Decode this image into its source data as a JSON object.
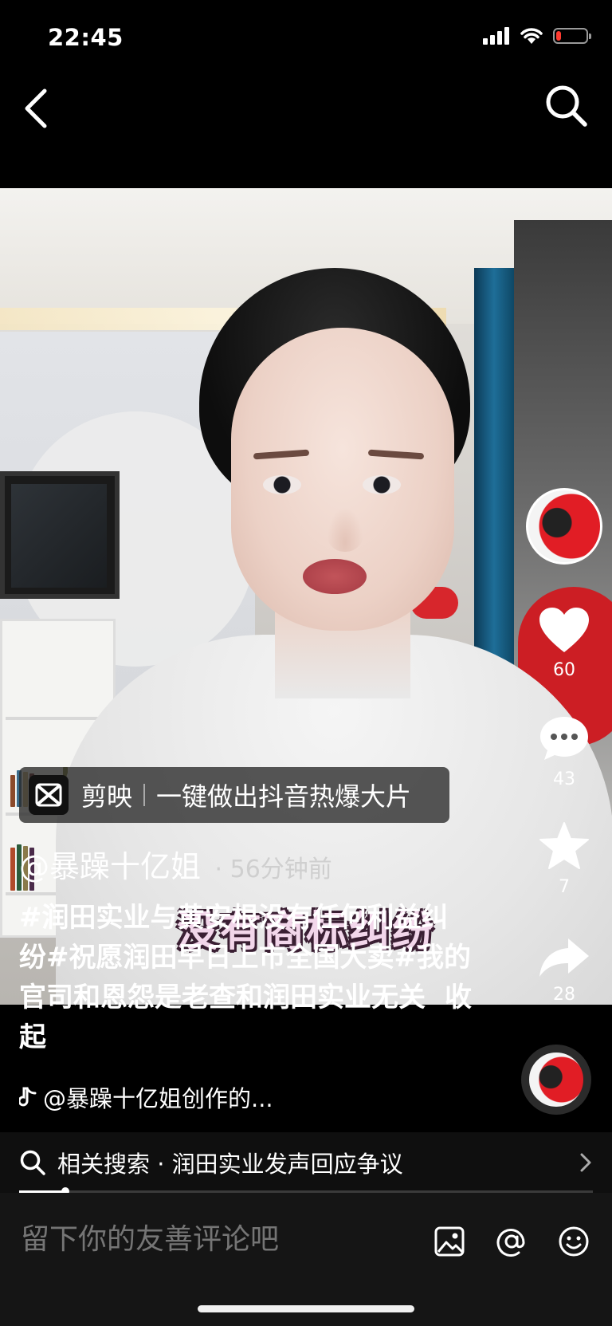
{
  "status_bar": {
    "time": "22:45",
    "battery_level": 0.18,
    "battery_color": "#ff3b30"
  },
  "nav": {
    "back_icon": "chevron-left-icon",
    "search_icon": "search-icon"
  },
  "video": {
    "caption": "没有商标纠纷",
    "capcut": {
      "name": "剪映",
      "slogan": "一键做出抖音热爆大片"
    }
  },
  "rail": {
    "likes": "60",
    "comments": "43",
    "favorites": "7",
    "shares": "28"
  },
  "post": {
    "author": "@暴躁十亿姐",
    "time_ago": "56分钟前",
    "description": "#润田实业与黄安根没有任何利益纠纷#祝愿润田早日上市全国大卖#我的官司和恩怨是老查和润田实业无关",
    "collapse_label": "收起",
    "music": "@暴躁十亿姐创作的..."
  },
  "related": {
    "text": "相关搜索 · 润田实业发声回应争议"
  },
  "playback": {
    "progress": 0.08
  },
  "comment_bar": {
    "placeholder": "留下你的友善评论吧"
  },
  "colors": {
    "accent_red": "#e11d25",
    "background": "#000000"
  }
}
